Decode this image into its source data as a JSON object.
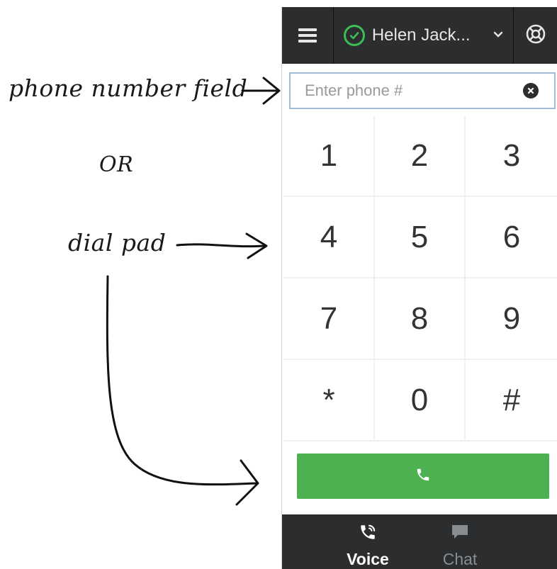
{
  "annotations": {
    "phone_field": "phone number field",
    "or": "OR",
    "dial_pad": "dial pad"
  },
  "header": {
    "agent_name": "Helen Jack...",
    "status": "available",
    "status_color": "#3bbf55"
  },
  "phone_input": {
    "placeholder": "Enter phone #",
    "value": ""
  },
  "keypad": {
    "keys": [
      "1",
      "2",
      "3",
      "4",
      "5",
      "6",
      "7",
      "8",
      "9",
      "*",
      "0",
      "#"
    ]
  },
  "call_button": {
    "icon": "phone-icon",
    "color": "#4db151"
  },
  "tabs": [
    {
      "label": "Voice",
      "icon": "voice-icon",
      "active": true
    },
    {
      "label": "Chat",
      "icon": "chat-icon",
      "active": false
    }
  ],
  "colors": {
    "bar_bg": "#2b2d2f",
    "input_border": "#9fbcd9"
  }
}
